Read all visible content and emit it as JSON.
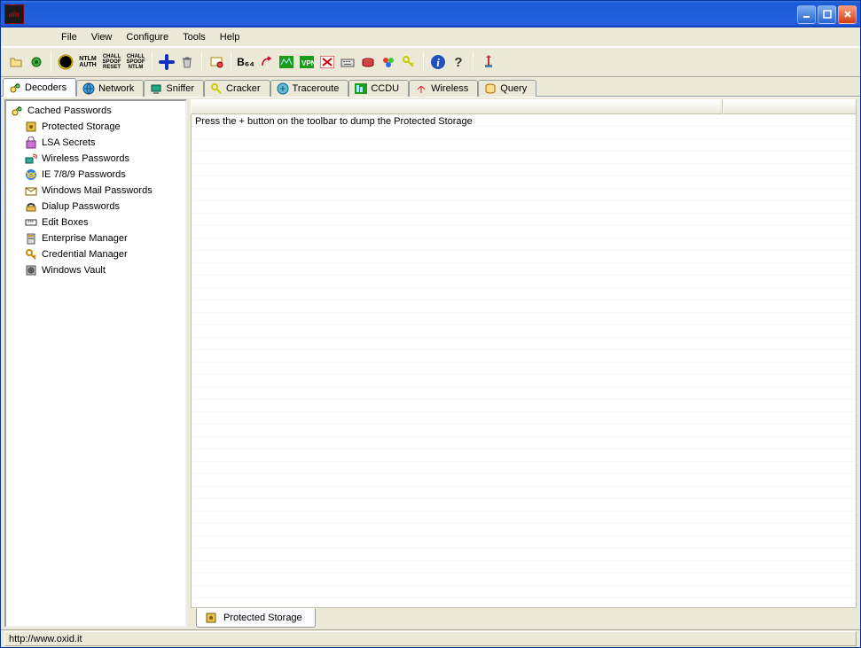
{
  "window": {
    "title": ""
  },
  "menubar": [
    "File",
    "View",
    "Configure",
    "Tools",
    "Help"
  ],
  "toolbar_text": {
    "auth": "NTLM\nAUTH",
    "spoof_reset": "SPOOF\nRESET",
    "chall_ntlm": "CHALL\nSPOOF\nNTLM",
    "chall_reset": "CHALL\nSPOOF\nRESET",
    "b64": "B₆₄"
  },
  "tabs": [
    {
      "label": "Decoders"
    },
    {
      "label": "Network"
    },
    {
      "label": "Sniffer"
    },
    {
      "label": "Cracker"
    },
    {
      "label": "Traceroute"
    },
    {
      "label": "CCDU"
    },
    {
      "label": "Wireless"
    },
    {
      "label": "Query"
    }
  ],
  "sidebar": {
    "root": "Cached Passwords",
    "items": [
      "Protected Storage",
      "LSA Secrets",
      "Wireless Passwords",
      "IE 7/8/9 Passwords",
      "Windows Mail Passwords",
      "Dialup Passwords",
      "Edit Boxes",
      "Enterprise Manager",
      "Credential Manager",
      "Windows Vault"
    ]
  },
  "content": {
    "message": "Press the + button on the toolbar to dump the Protected Storage"
  },
  "bottom_tab": {
    "label": "Protected Storage"
  },
  "status": {
    "url": "http://www.oxid.it"
  }
}
